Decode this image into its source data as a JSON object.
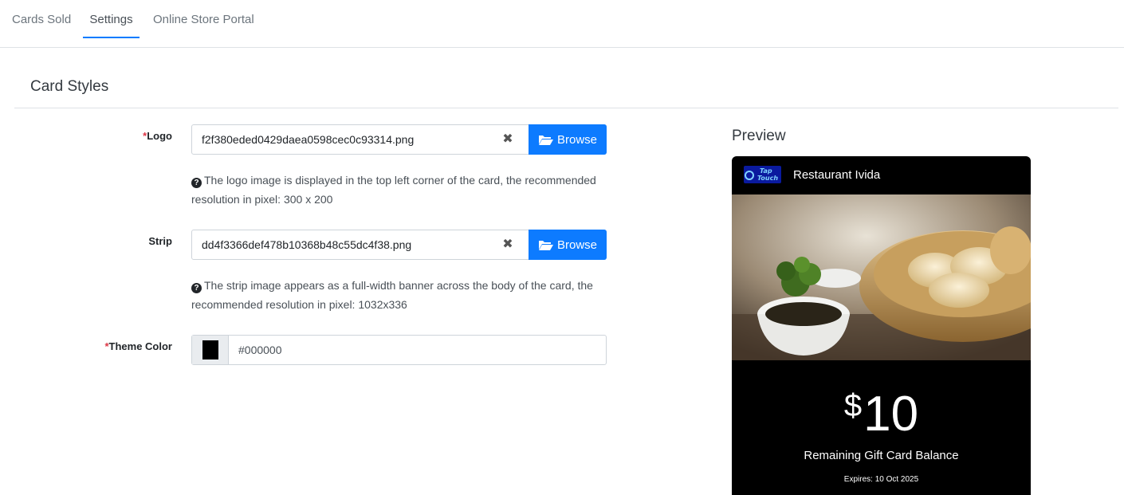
{
  "tabs": [
    {
      "label": "Cards Sold"
    },
    {
      "label": "Settings"
    },
    {
      "label": "Online Store Portal"
    }
  ],
  "section": {
    "title": "Card Styles"
  },
  "fields": {
    "required_mark": "*",
    "logo": {
      "label": "Logo",
      "file_name": "f2f380eded0429daea0598cec0c93314.png",
      "clear_glyph": "✖",
      "browse_label": "Browse",
      "help": "The logo image is displayed in the top left corner of the card, the recommended resolution in pixel: 300 x 200"
    },
    "strip": {
      "label": "Strip",
      "file_name": "dd4f3366def478b10368b48c55dc4f38.png",
      "clear_glyph": "✖",
      "browse_label": "Browse",
      "help": "The strip image appears as a full-width banner across the body of the card, the recommended resolution in pixel: 1032x336"
    },
    "theme_color": {
      "label": "Theme Color",
      "value": "#000000"
    }
  },
  "preview": {
    "title": "Preview",
    "logo_text_top": "Tap",
    "logo_text_bottom": "Touch",
    "restaurant_name": "Restaurant Ivida",
    "currency": "$",
    "amount": "10",
    "balance_label": "Remaining Gift Card Balance",
    "expires": "Expires: 10 Oct 2025"
  },
  "colors": {
    "accent": "#0d7bff",
    "required": "#dc3545",
    "card_bg": "#000000"
  },
  "icons": {
    "browse": "folder-open-icon",
    "help": "question-circle-icon",
    "clear": "close-icon"
  }
}
